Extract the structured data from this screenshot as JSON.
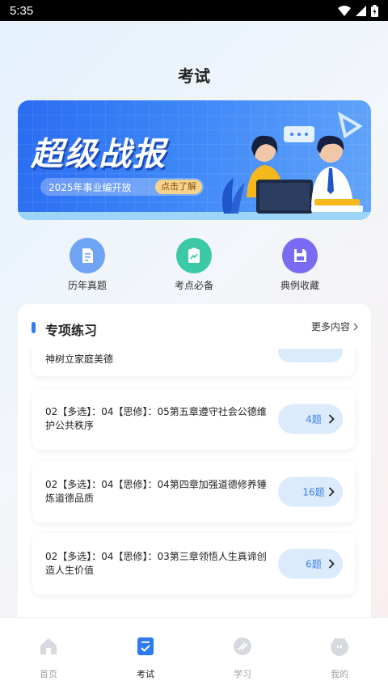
{
  "status_bar": {
    "time": "5:35"
  },
  "header": {
    "title": "考试"
  },
  "banner": {
    "title": "超级战报",
    "subtitle": "2025年事业编开放",
    "cta": "点击了解"
  },
  "quick_actions": [
    {
      "label": "历年真题",
      "icon": "document-icon",
      "color": "#6fa4f5"
    },
    {
      "label": "考点必备",
      "icon": "chart-clipboard-icon",
      "color": "#3cc9a6"
    },
    {
      "label": "典例收藏",
      "icon": "save-icon",
      "color": "#7a6cf2"
    }
  ],
  "practice": {
    "title": "专项练习",
    "more": "更多内容",
    "items": [
      {
        "text": "神树立家庭美德",
        "count": ""
      },
      {
        "text": "02【多选】：04【思修】：05第五章遵守社会公德维护公共秩序",
        "count": "4题"
      },
      {
        "text": "02【多选】：04【思修】：04第四章加强道德修养锤炼道德品质",
        "count": "16题"
      },
      {
        "text": "02【多选】：04【思修】：03第三章领悟人生真谛创造人生价值",
        "count": "6题"
      }
    ]
  },
  "tabbar": {
    "tabs": [
      {
        "label": "首页",
        "icon": "home-icon"
      },
      {
        "label": "考试",
        "icon": "exam-icon"
      },
      {
        "label": "学习",
        "icon": "study-icon"
      },
      {
        "label": "我的",
        "icon": "profile-icon"
      }
    ],
    "active": "考试"
  },
  "colors": {
    "accent": "#2f7bf5",
    "button_bg": "#dcebfc",
    "button_text": "#3b82e6"
  }
}
